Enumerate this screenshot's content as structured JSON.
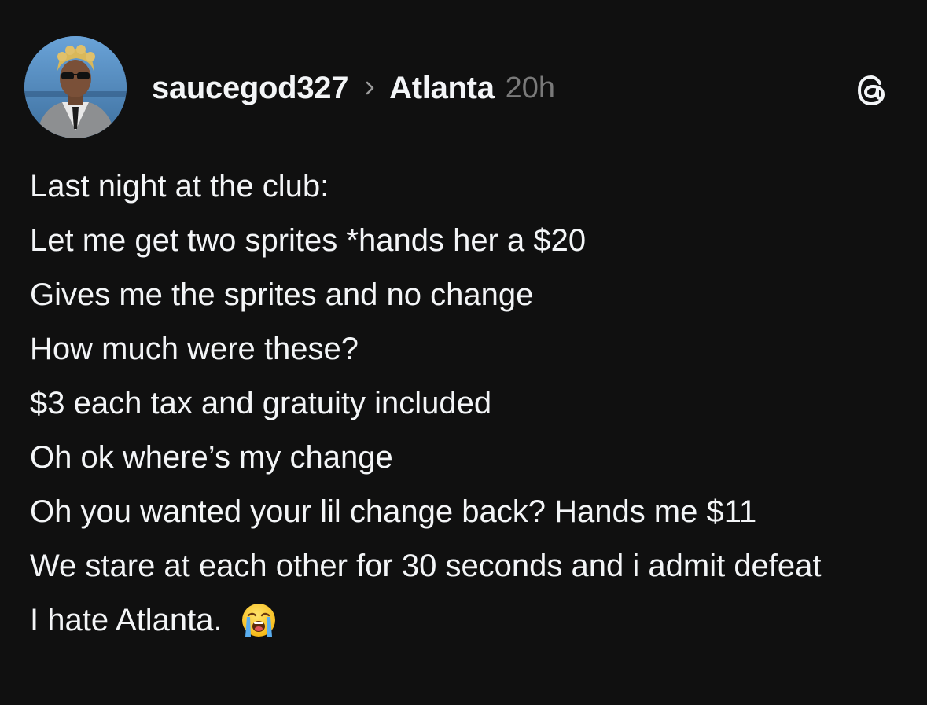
{
  "post": {
    "username": "saucegod327",
    "location": "Atlanta",
    "timestamp": "20h",
    "lines": [
      "Last night at the club:",
      "Let me get two sprites *hands her a $20",
      "Gives me the sprites and no change",
      "How much were these?",
      "$3 each tax and gratuity included",
      "Oh ok where’s my change",
      "Oh you wanted your lil change back? Hands me $11",
      "We stare at each other for 30 seconds and i admit defeat",
      "I hate Atlanta."
    ],
    "emoji": "loudly-crying-face"
  },
  "icons": {
    "app_logo": "threads-icon",
    "chevron": "chevron-right-icon"
  },
  "colors": {
    "background": "#101010",
    "text": "#f3f5f7",
    "muted": "#7a7a7a"
  }
}
